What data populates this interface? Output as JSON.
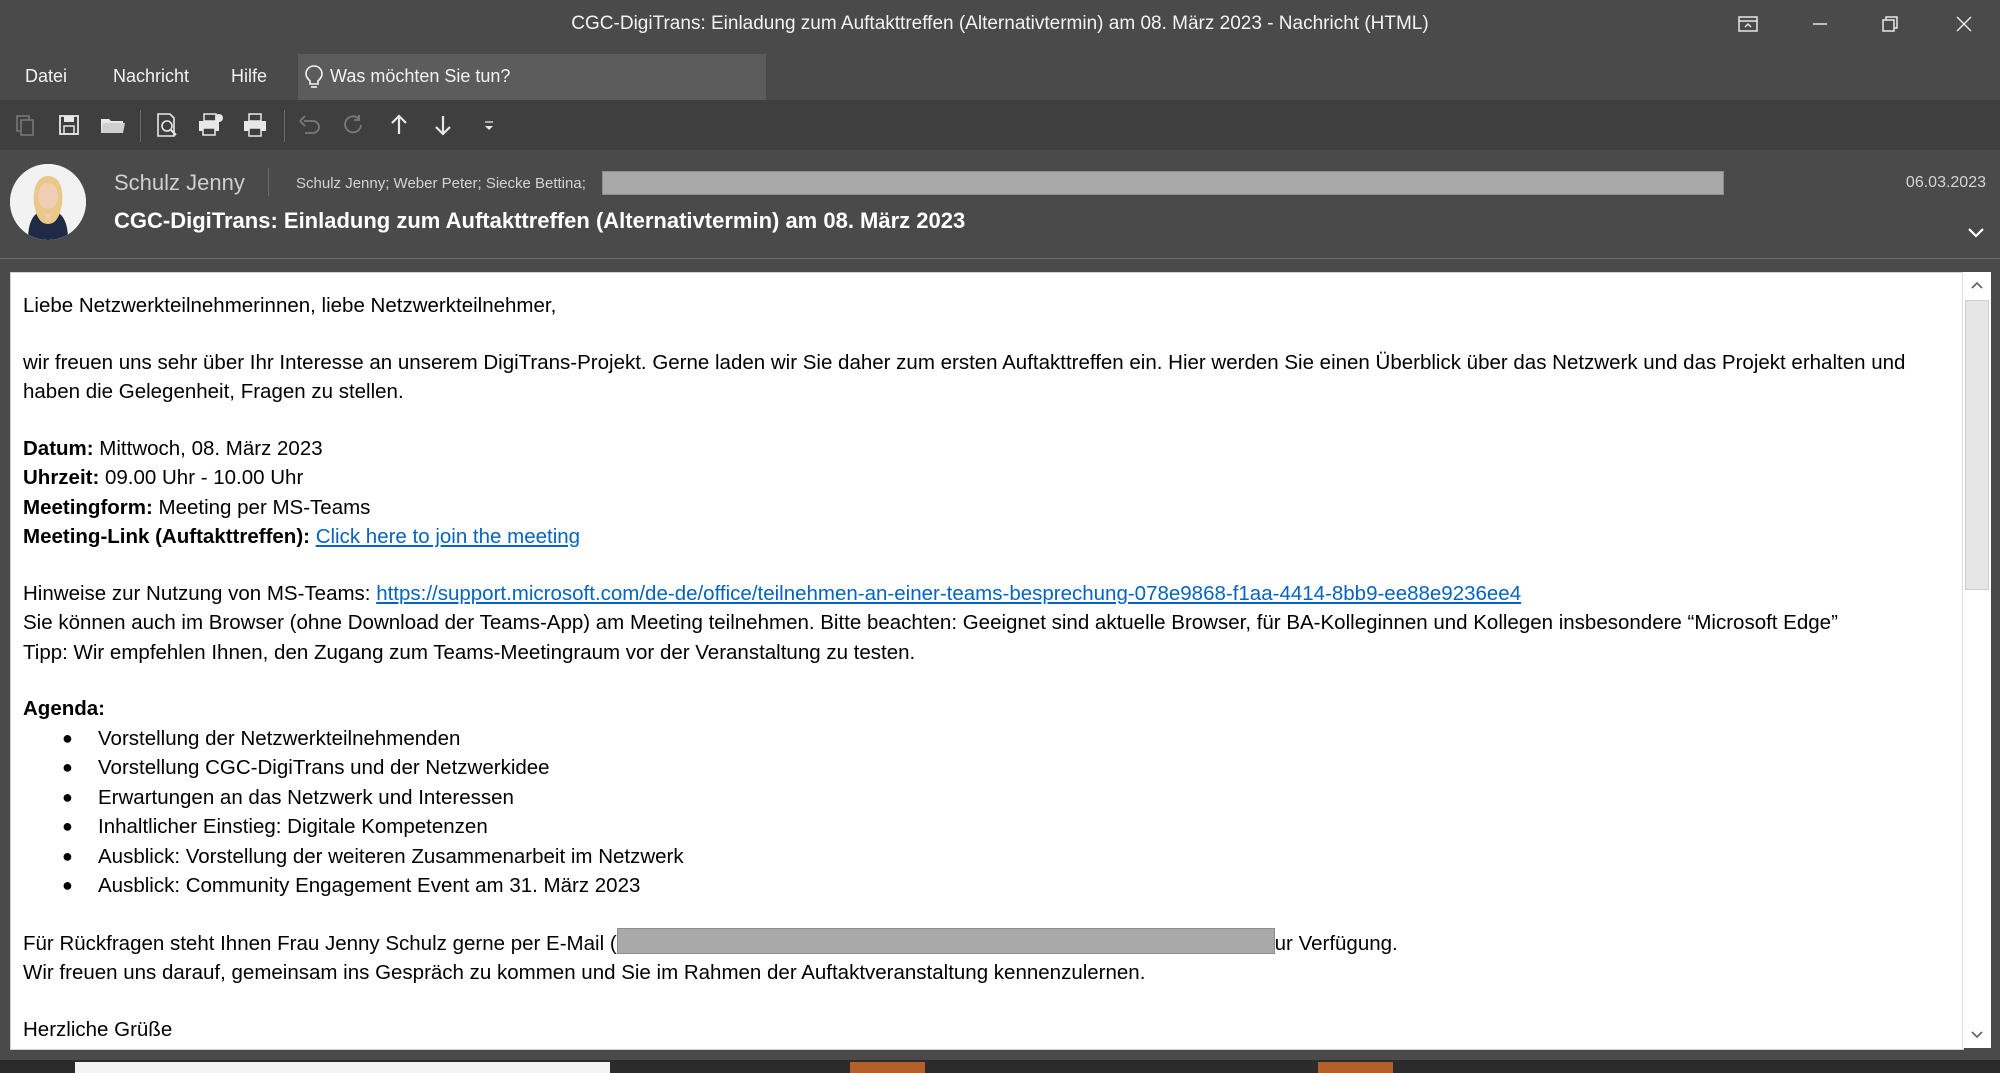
{
  "window": {
    "title": "CGC-DigiTrans: Einladung zum Auftakttreffen (Alternativtermin) am 08. März 2023  -  Nachricht (HTML)",
    "controls": [
      "ribbon-display-options-icon",
      "minimize-icon",
      "restore-icon",
      "close-icon"
    ]
  },
  "menu": {
    "items": [
      "Datei",
      "Nachricht",
      "Hilfe"
    ],
    "tell_me": "Was möchten Sie tun?"
  },
  "toolbar": {
    "icons": [
      "copy-icon",
      "save-icon",
      "open-folder-icon",
      "print-preview-icon",
      "print-setup-icon",
      "print-icon",
      "undo-icon",
      "redo-icon",
      "previous-item-icon",
      "next-item-icon",
      "customize-quick-access-icon"
    ]
  },
  "header": {
    "sender": "Schulz Jenny",
    "recipients": "Schulz Jenny; Weber Peter; Siecke Bettina;",
    "date": "06.03.2023",
    "subject": "CGC-DigiTrans: Einladung zum Auftakttreffen (Alternativtermin) am 08. März 2023"
  },
  "body": {
    "greeting": "Liebe Netzwerkteilnehmerinnen, liebe Netzwerkteilnehmer,",
    "intro": "wir freuen uns sehr über Ihr Interesse an unserem DigiTrans-Projekt. Gerne laden wir Sie daher zum ersten Auftakttreffen ein. Hier werden Sie einen Überblick über das Netzwerk und das Projekt erhalten und haben die Gelegenheit, Fragen zu stellen.",
    "datum_label": "Datum:",
    "datum_value": " Mittwoch, 08. März 2023",
    "uhrzeit_label": "Uhrzeit:",
    "uhrzeit_value": " 09.00 Uhr - 10.00 Uhr",
    "meetingform_label": "Meetingform:",
    "meetingform_value": " Meeting per MS-Teams",
    "meetinglink_label": "Meeting-Link (Auftakttreffen):",
    "meetinglink_text": "Click here to join the meeting",
    "hinweise_prefix": "Hinweise zur Nutzung von MS-Teams: ",
    "hinweise_link": "https://support.microsoft.com/de-de/office/teilnehmen-an-einer-teams-besprechung-078e9868-f1aa-4414-8bb9-ee88e9236ee4",
    "browser_note": "Sie können auch im Browser (ohne Download der Teams-App) am Meeting teilnehmen. Bitte beachten: Geeignet sind aktuelle Browser, für BA-Kolleginnen und Kollegen insbesondere “Microsoft Edge”",
    "tipp": "Tipp: Wir empfehlen Ihnen, den Zugang zum Teams-Meetingraum vor der Veranstaltung zu testen.",
    "agenda_label": "Agenda:",
    "agenda": [
      "Vorstellung der Netzwerkteilnehmenden",
      "Vorstellung CGC-DigiTrans und der Netzwerkidee",
      "Erwartungen an das Netzwerk und Interessen",
      "Inhaltlicher Einstieg: Digitale Kompetenzen",
      "Ausblick: Vorstellung der weiteren Zusammenarbeit im Netzwerk",
      "Ausblick: Community Engagement Event am 31. März 2023"
    ],
    "rueckfragen_prefix": "Für Rückfragen steht Ihnen Frau Jenny Schulz gerne per E-Mail (",
    "rueckfragen_suffix": "ur Verfügung.",
    "closing_line": "Wir freuen uns darauf, gemeinsam ins Gespräch zu kommen und Sie im Rahmen der Auftaktveranstaltung kennenzulernen.",
    "regards": "Herzliche Grüße"
  }
}
